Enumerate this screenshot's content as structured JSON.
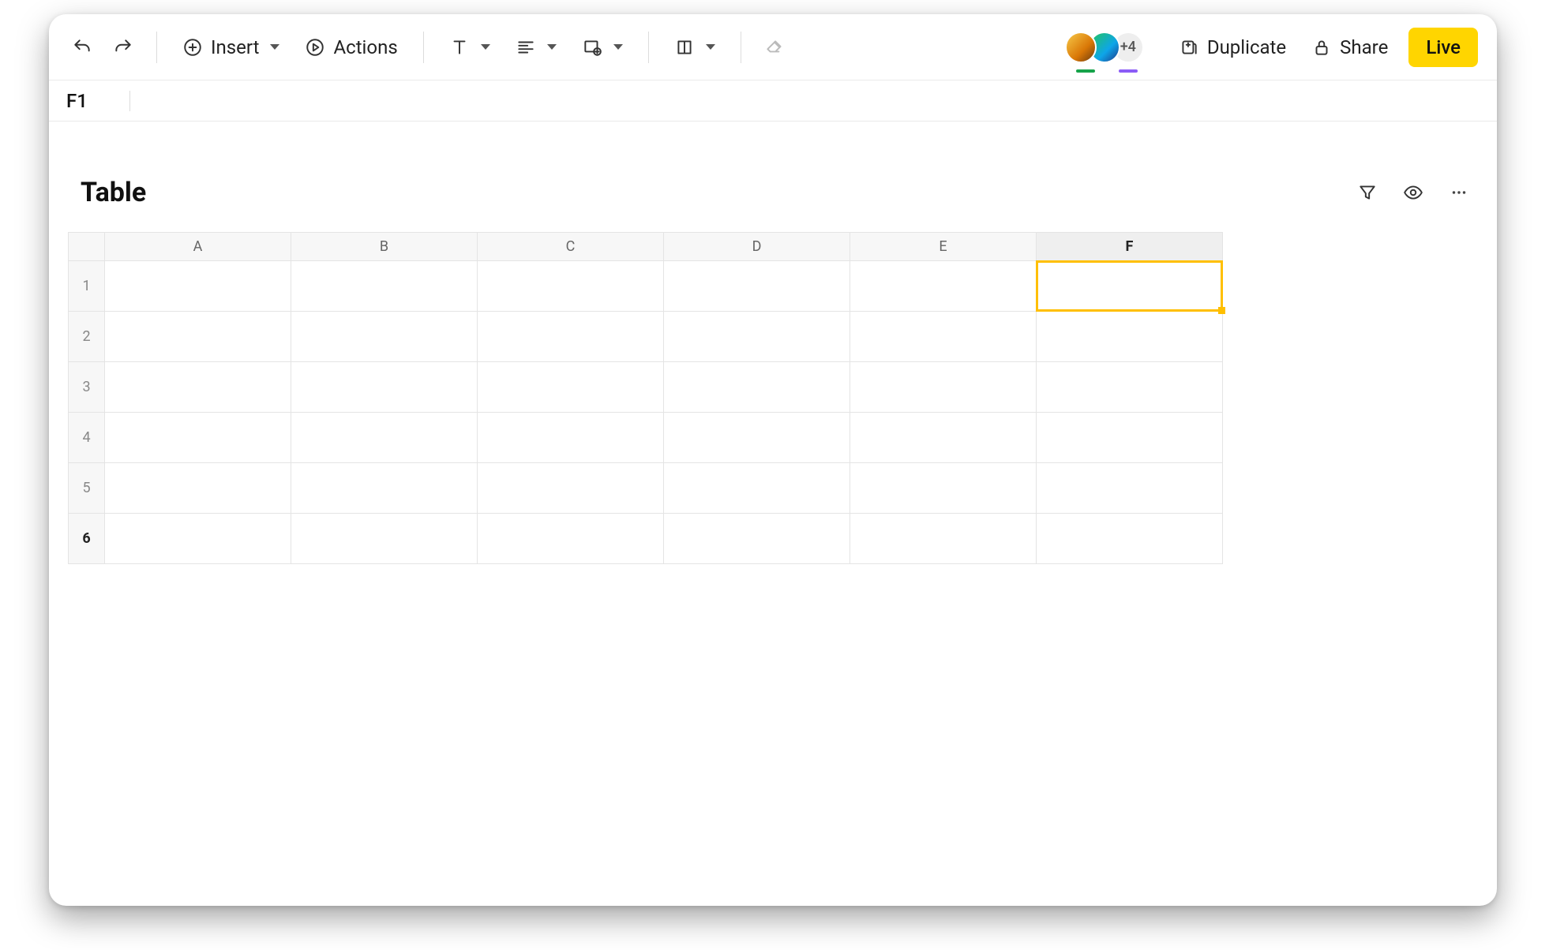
{
  "toolbar": {
    "insert_label": "Insert",
    "actions_label": "Actions",
    "duplicate_label": "Duplicate",
    "share_label": "Share",
    "live_label": "Live",
    "avatar_extra": "+4"
  },
  "formula_bar": {
    "cell_ref": "F1",
    "value": ""
  },
  "sheet": {
    "title": "Table",
    "selected_cell": "F1",
    "columns": [
      "A",
      "B",
      "C",
      "D",
      "E",
      "F"
    ],
    "active_column_index": 5,
    "rows": [
      {
        "n": "1",
        "bold": false
      },
      {
        "n": "2",
        "bold": false
      },
      {
        "n": "3",
        "bold": false
      },
      {
        "n": "4",
        "bold": false
      },
      {
        "n": "5",
        "bold": false
      },
      {
        "n": "6",
        "bold": true
      }
    ]
  }
}
